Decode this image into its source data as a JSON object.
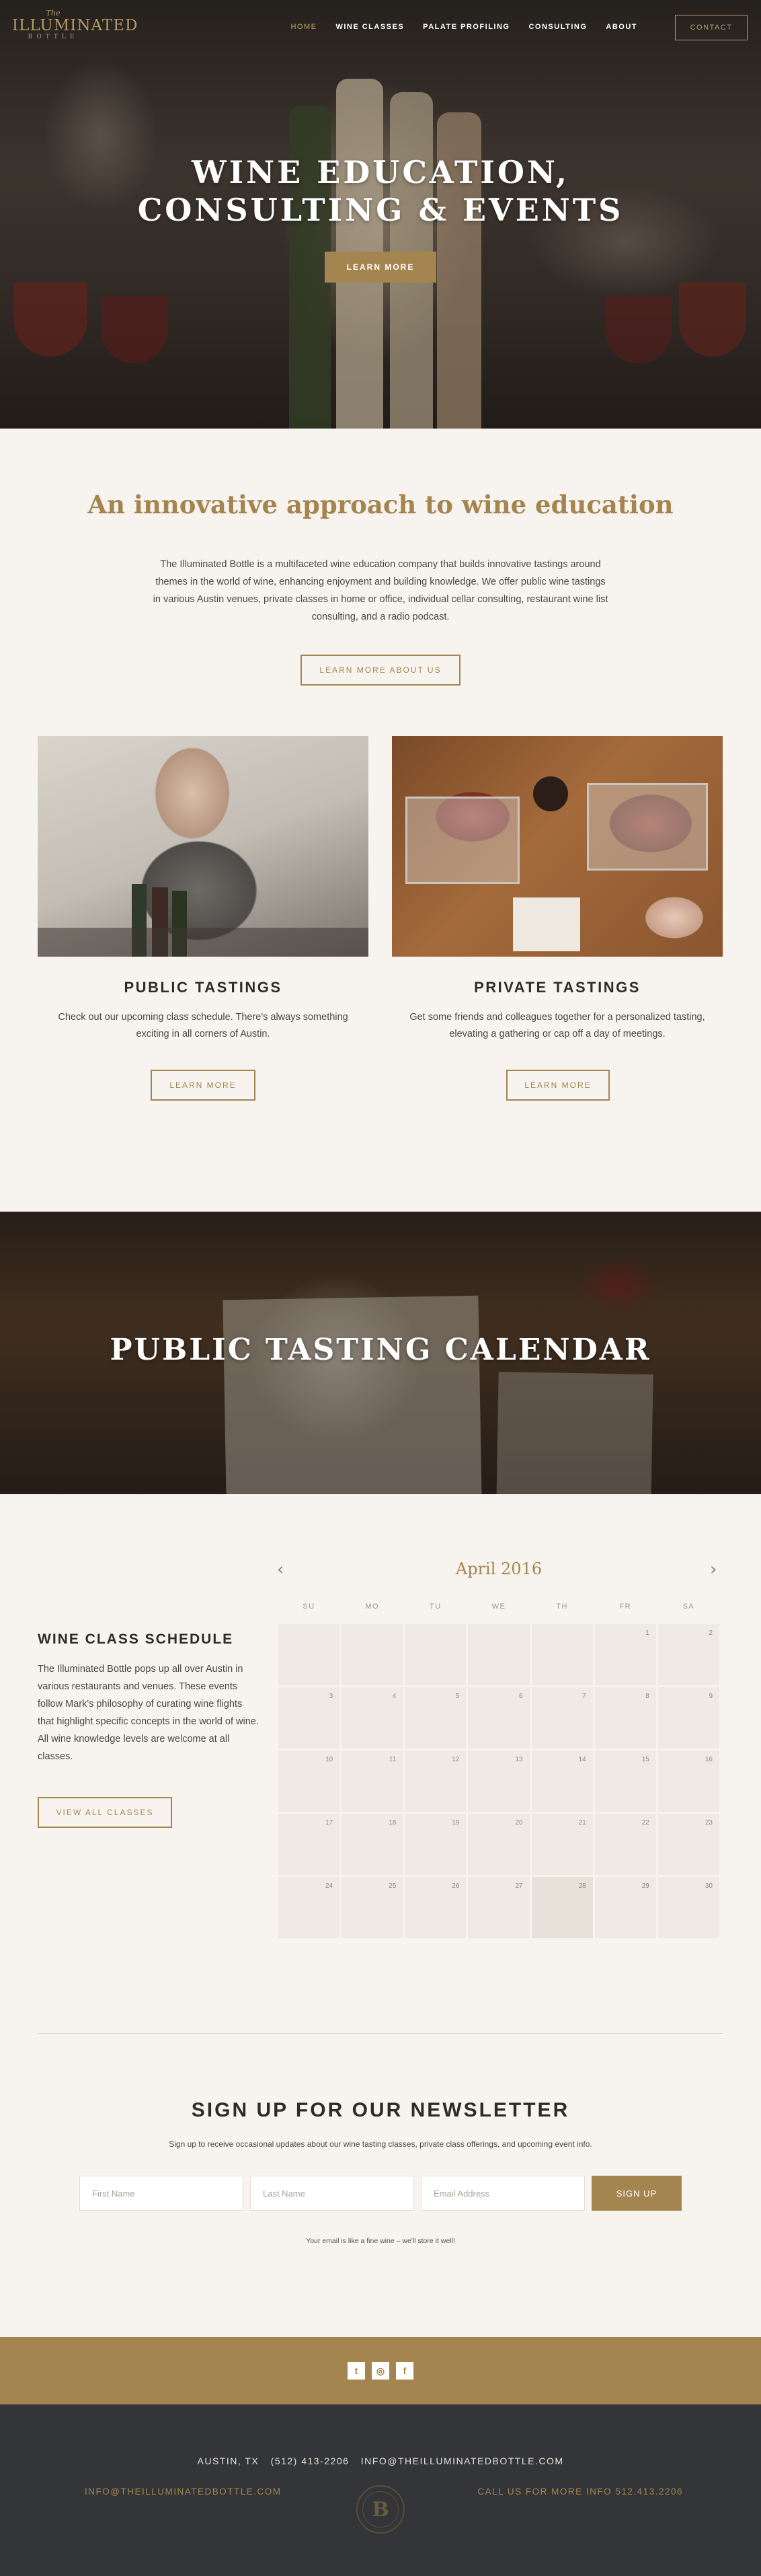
{
  "brand": {
    "logo_the": "The",
    "logo_name": "ILLUMINATED",
    "logo_sub": "BOTTLE"
  },
  "nav": {
    "items": [
      {
        "label": "HOME",
        "active": true
      },
      {
        "label": "WINE CLASSES",
        "active": false
      },
      {
        "label": "PALATE PROFILING",
        "active": false
      },
      {
        "label": "CONSULTING",
        "active": false
      },
      {
        "label": "ABOUT",
        "active": false
      }
    ],
    "contact_label": "CONTACT"
  },
  "hero": {
    "title_line1": "WINE EDUCATION,",
    "title_line2": "CONSULTING & EVENTS",
    "button_label": "LEARN MORE"
  },
  "intro": {
    "title": "An innovative approach to wine education",
    "text": "The Illuminated Bottle is a multifaceted wine education company that builds innovative tastings around themes in the world of wine, enhancing enjoyment and building knowledge.  We offer public wine tastings in various Austin venues, private classes in home or office, individual cellar consulting, restaurant wine list consulting, and a radio podcast.",
    "button_label": "LEARN MORE ABOUT US"
  },
  "features": [
    {
      "title": "PUBLIC TASTINGS",
      "text": "Check out our upcoming class schedule. There's always something exciting in all corners of Austin.",
      "button_label": "LEARN MORE"
    },
    {
      "title": "PRIVATE TASTINGS",
      "text": "Get some friends and colleagues together for a personalized tasting, elevating a gathering or cap off a day of meetings.",
      "button_label": "LEARN MORE"
    }
  ],
  "calendar_banner": {
    "title": "PUBLIC TASTING CALENDAR"
  },
  "schedule": {
    "title": "WINE CLASS SCHEDULE",
    "text": "The Illuminated Bottle pops up all over Austin in various restaurants and venues. These events follow Mark's philosophy of curating wine flights that highlight specific concepts in the world of wine. All wine knowledge levels are welcome at all classes.",
    "button_label": "VIEW ALL CLASSES"
  },
  "calendar": {
    "month": "April 2016",
    "prev_icon": "‹",
    "next_icon": "›",
    "weekdays": [
      "SU",
      "MO",
      "TU",
      "WE",
      "TH",
      "FR",
      "SA"
    ],
    "today": "28",
    "days": [
      "",
      "",
      "",
      "",
      "",
      "1",
      "2",
      "3",
      "4",
      "5",
      "6",
      "7",
      "8",
      "9",
      "10",
      "11",
      "12",
      "13",
      "14",
      "15",
      "16",
      "17",
      "18",
      "19",
      "20",
      "21",
      "22",
      "23",
      "24",
      "25",
      "26",
      "27",
      "28",
      "29",
      "30"
    ]
  },
  "newsletter": {
    "title": "SIGN UP FOR OUR NEWSLETTER",
    "subtitle": "Sign up to receive occasional updates about our wine tasting classes, private class offerings, and upcoming event info.",
    "first_name_placeholder": "First Name",
    "last_name_placeholder": "Last Name",
    "email_placeholder": "Email Address",
    "submit_label": "SIGN UP",
    "note": "Your email is like a fine wine – we'll store it well!"
  },
  "social": {
    "icons": [
      {
        "name": "twitter-icon",
        "glyph": "t"
      },
      {
        "name": "instagram-icon",
        "glyph": "◎"
      },
      {
        "name": "facebook-icon",
        "glyph": "f"
      }
    ]
  },
  "footer": {
    "city": "AUSTIN, TX",
    "phone": "(512) 413-2206",
    "email": "INFO@THEILLUMINATEDBOTTLE.COM",
    "left_email": "INFO@THEILLUMINATEDBOTTLE.COM",
    "right_text": "CALL US FOR MORE INFO 512.413.2206",
    "badge_letter": "B"
  },
  "colors": {
    "accent": "#a5854f",
    "footer_bg": "#333538",
    "page_bg": "#f7f4ef"
  }
}
